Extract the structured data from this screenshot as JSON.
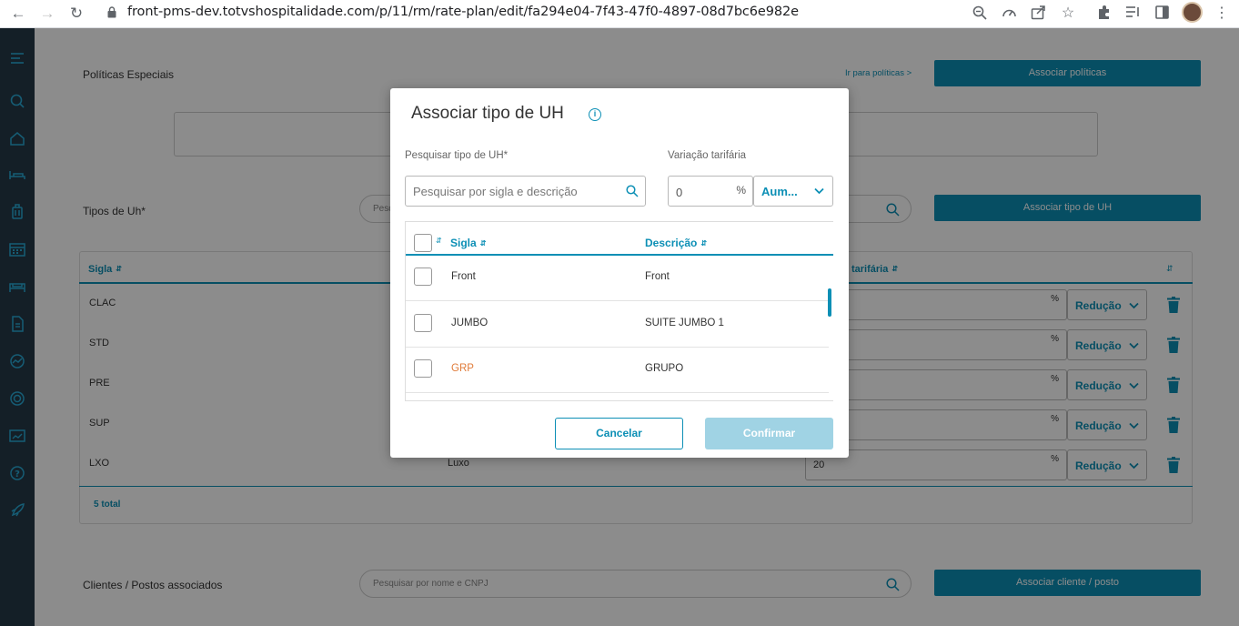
{
  "browser": {
    "url": "front-pms-dev.totvshospitalidade.com/p/11/rm/rate-plan/edit/fa294e04-7f43-47f0-4897-08d7bc6e982e"
  },
  "sidebar": {
    "icons": [
      "menu-icon",
      "search-icon",
      "home-icon",
      "bed-icon",
      "luggage-icon",
      "calendar-icon",
      "room-icon",
      "document-icon",
      "chart-icon",
      "target-icon",
      "dashboard-icon",
      "help-icon",
      "rocket-icon"
    ]
  },
  "page": {
    "special_policies": {
      "label": "Políticas Especiais",
      "link": "Ir para políticas >",
      "button": "Associar políticas"
    },
    "room_types": {
      "label": "Tipos de Uh*",
      "search_placeholder": "Pesq",
      "button": "Associar tipo de UH",
      "headers": {
        "sigla": "Sigla",
        "tarifaria": "tarifária"
      },
      "rows": [
        {
          "sigla": "CLAC",
          "descricao": "",
          "valor": "",
          "tipo": "Redução"
        },
        {
          "sigla": "STD",
          "descricao": "",
          "valor": "",
          "tipo": "Redução"
        },
        {
          "sigla": "PRE",
          "descricao": "",
          "valor": "",
          "tipo": "Redução"
        },
        {
          "sigla": "SUP",
          "descricao": "",
          "valor": "",
          "tipo": "Redução"
        },
        {
          "sigla": "LXO",
          "descricao": "Luxo",
          "valor": "20",
          "tipo": "Redução"
        }
      ],
      "percent": "%",
      "total": "5 total"
    },
    "clients": {
      "label": "Clientes / Postos associados",
      "search_placeholder": "Pesquisar por nome e CNPJ",
      "button": "Associar cliente / posto"
    }
  },
  "modal": {
    "title": "Associar tipo de UH",
    "search_label": "Pesquisar tipo de UH*",
    "search_placeholder": "Pesquisar por sigla e descrição",
    "variation_label": "Variação tarifária",
    "variation_value": "0",
    "percent": "%",
    "variation_type": "Aum...",
    "headers": {
      "sigla": "Sigla",
      "descricao": "Descrição"
    },
    "rows": [
      {
        "sigla": "Front",
        "descricao": "Front"
      },
      {
        "sigla": "JUMBO",
        "descricao": "SUITE JUMBO 1"
      },
      {
        "sigla": "GRP",
        "descricao": "GRUPO"
      }
    ],
    "cancel": "Cancelar",
    "confirm": "Confirmar"
  },
  "colors": {
    "primary": "#0c8fb5",
    "sidebar": "#253a47",
    "confirm_disabled": "#a0d3e4",
    "highlight_text": "#e07b39"
  }
}
